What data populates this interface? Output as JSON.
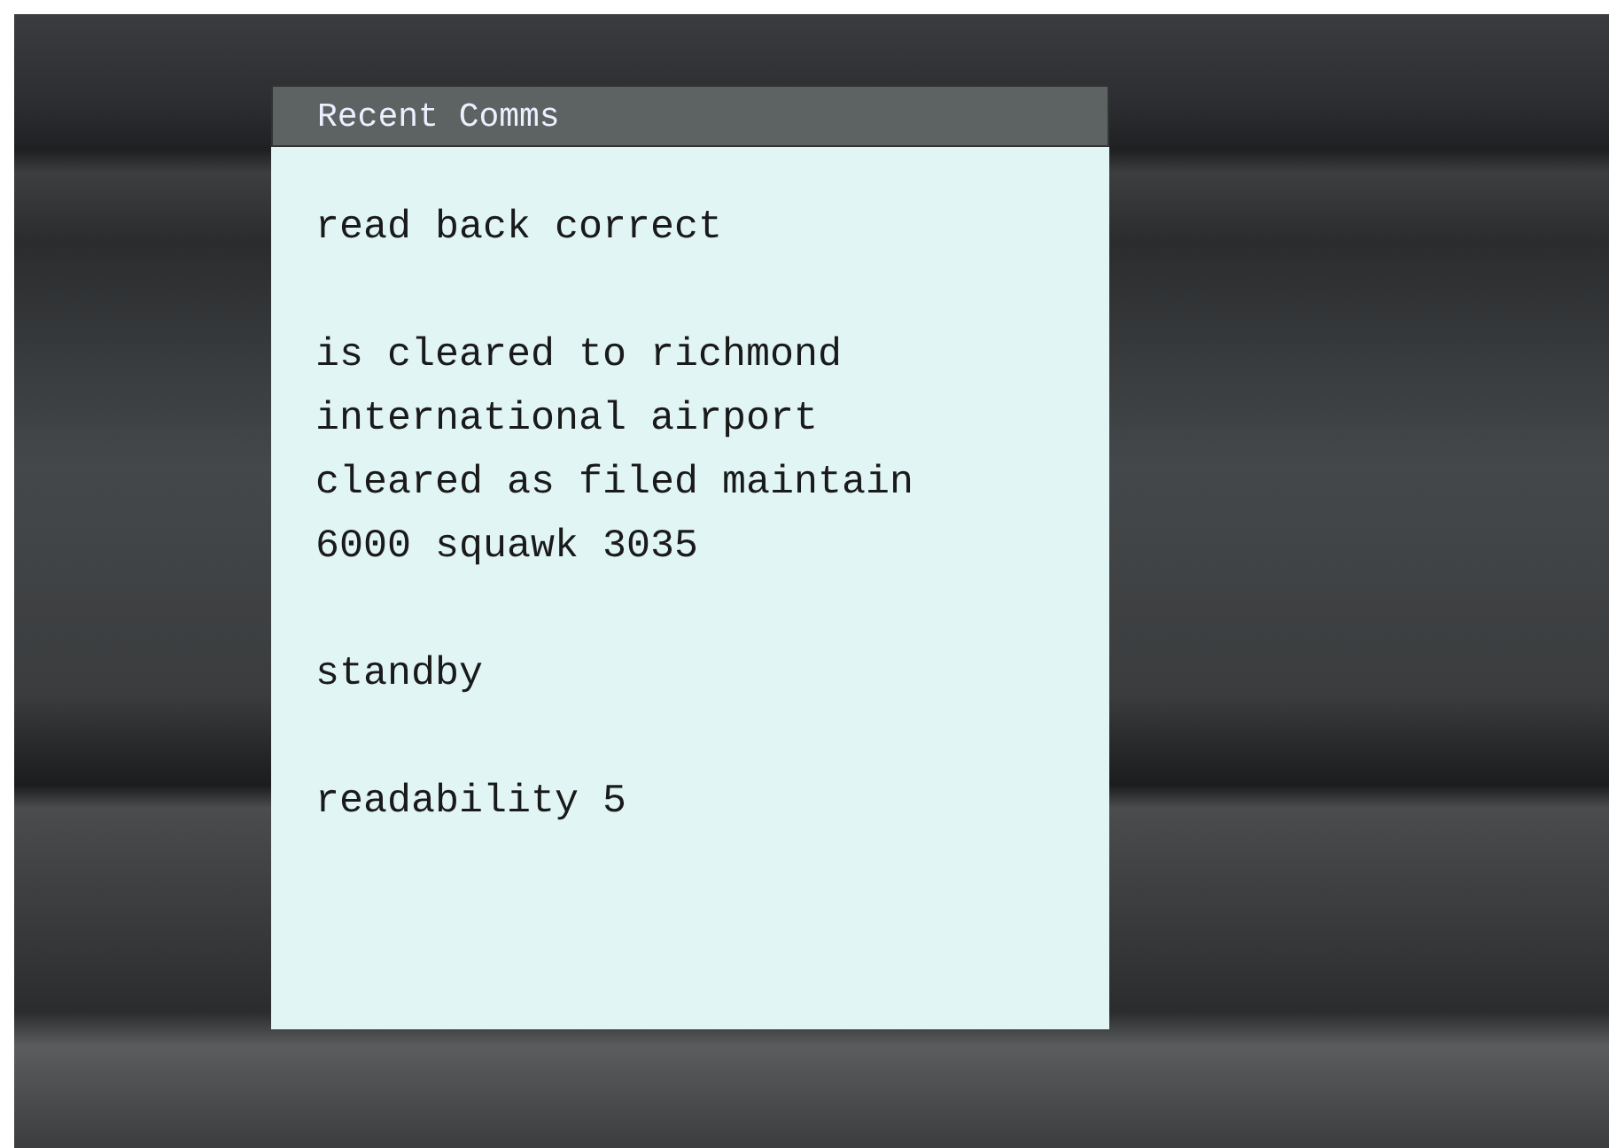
{
  "panel": {
    "title": "Recent Comms",
    "messages": [
      {
        "lines": [
          "read back correct"
        ]
      },
      {
        "lines": [
          "is cleared to richmond",
          "international airport",
          "cleared as filed maintain",
          "6000 squawk 3035"
        ]
      },
      {
        "lines": [
          "standby"
        ]
      },
      {
        "lines": [
          "readability 5"
        ]
      }
    ]
  }
}
